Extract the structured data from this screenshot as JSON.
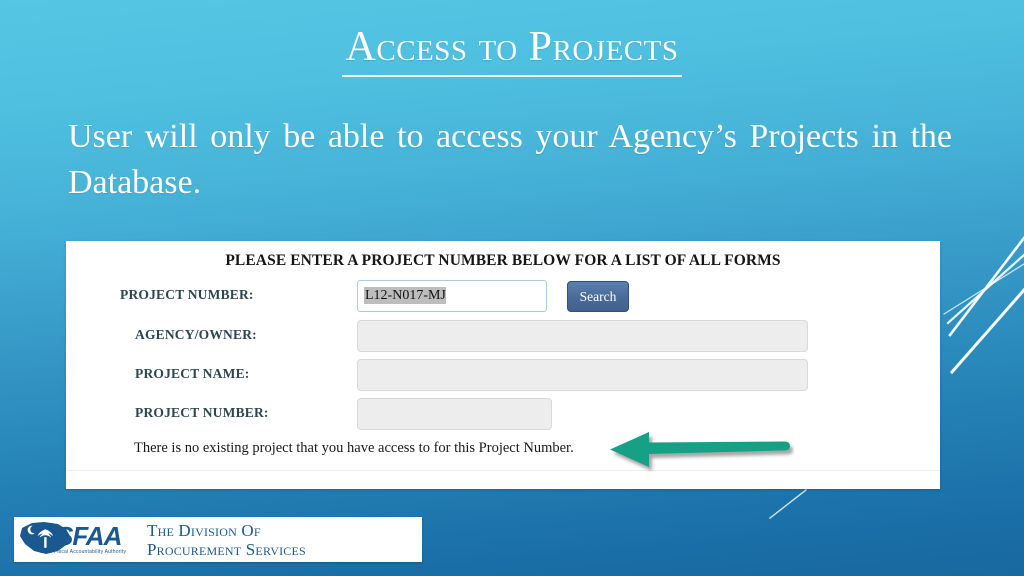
{
  "slide": {
    "title": "Access to Projects",
    "body": "User will only be able to access your Agency’s Projects in the Database."
  },
  "panel": {
    "heading": "PLEASE ENTER A PROJECT NUMBER BELOW FOR A LIST OF ALL FORMS",
    "fields": [
      {
        "label": "PROJECT NUMBER:",
        "value": "L12-N017-MJ"
      },
      {
        "label": "AGENCY/OWNER:",
        "value": ""
      },
      {
        "label": "PROJECT NAME:",
        "value": ""
      },
      {
        "label": "PROJECT NUMBER:",
        "value": ""
      }
    ],
    "search_button": "Search",
    "message": "There is no existing project that you have access to for this Project Number."
  },
  "annotation": {
    "arrow_color": "#18a085",
    "arrow_direction": "left"
  },
  "footer": {
    "logo_wordmark": "SFAA",
    "logo_tagline": "State Fiscal Accountability Authority",
    "line1": "The Division Of",
    "line2": "Procurement Services"
  },
  "theme": {
    "bg_top": "#55c6e4",
    "bg_bottom": "#17699f",
    "panel_bg": "#ffffff",
    "button_blue": "#4a6c9b",
    "logo_blue": "#1a5890",
    "accent_green": "#18a085"
  }
}
